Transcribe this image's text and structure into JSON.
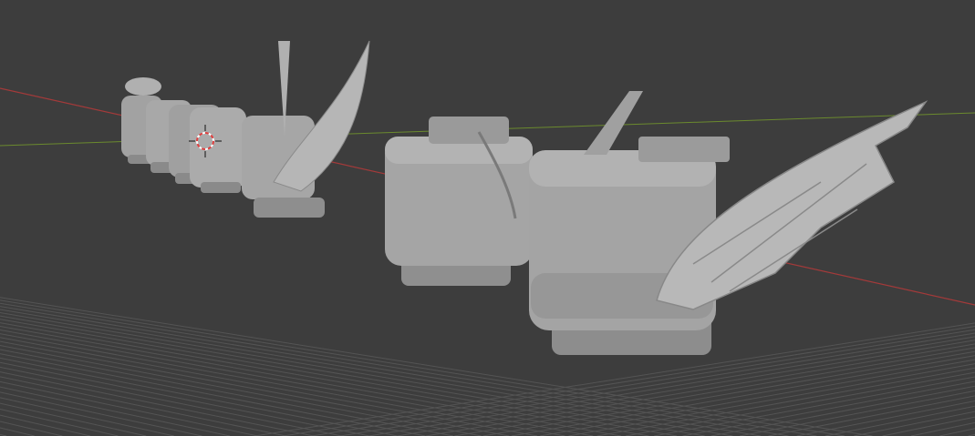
{
  "viewport": {
    "background": "#3d3d3d",
    "grid_color": "#545454",
    "x_axis_color": "#a33a3a",
    "y_axis_color": "#6b8a2e",
    "model_color": "#9c9c9c",
    "model_light": "#b4b4b4",
    "model_dark": "#7a7a7a",
    "cursor_color": "#e04040"
  }
}
